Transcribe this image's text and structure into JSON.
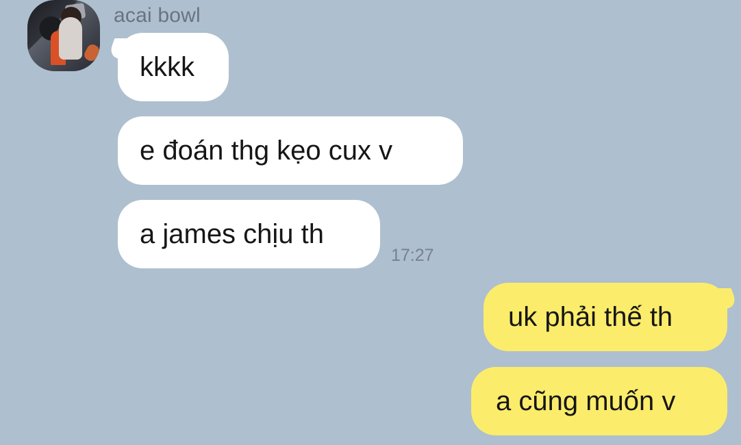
{
  "conversation": {
    "sender": "acai bowl",
    "avatar_icon": "profile-photo-icon",
    "messages": [
      {
        "text": "kkkk",
        "direction": "incoming",
        "bubble_color": "#ffffff"
      },
      {
        "text": "e đoán thg kẹo cux v",
        "direction": "incoming",
        "bubble_color": "#ffffff"
      },
      {
        "text": "a james chịu th",
        "direction": "incoming",
        "bubble_color": "#ffffff",
        "timestamp": "17:27"
      },
      {
        "text": "uk phải thế th",
        "direction": "outgoing",
        "bubble_color": "#fcec6b"
      },
      {
        "text": "a cũng muốn v",
        "direction": "outgoing",
        "bubble_color": "#fcec6b"
      }
    ]
  },
  "colors": {
    "background": "#aebfcf",
    "incoming": "#ffffff",
    "outgoing": "#fcec6b",
    "text": "#161616",
    "meta": "#778190"
  }
}
